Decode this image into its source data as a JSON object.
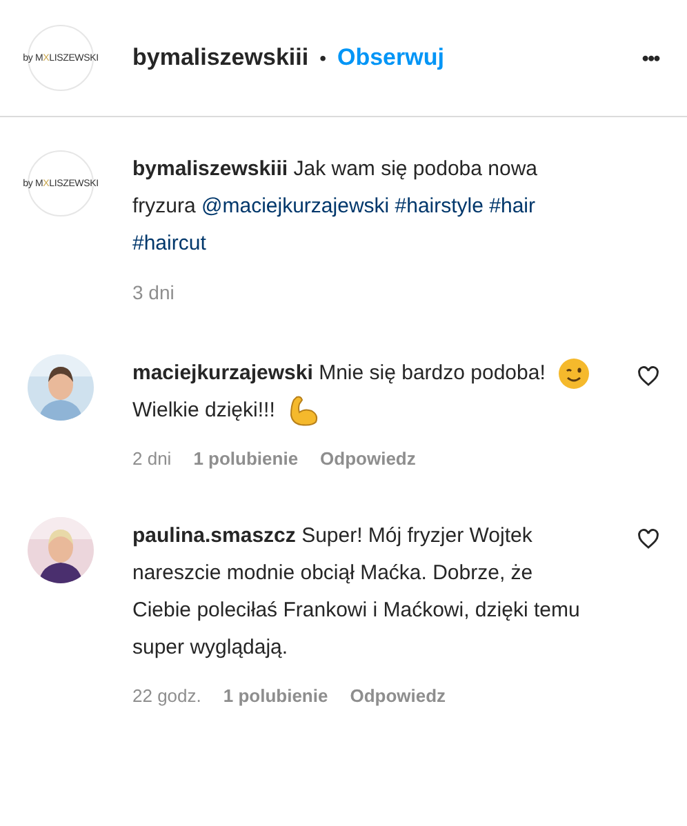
{
  "header": {
    "logo": {
      "prefix": "by M",
      "mark": "X",
      "suffix": "LISZEWSKI"
    },
    "username": "bymaliszewskiii",
    "separator": "•",
    "follow": "Obserwuj",
    "more": "•••"
  },
  "caption": {
    "logo": {
      "prefix": "by M",
      "mark": "X",
      "suffix": "LISZEWSKI"
    },
    "username": "bymaliszewskiii",
    "segments": [
      {
        "kind": "text",
        "text": "Jak wam się podoba nowa fryzura"
      },
      {
        "kind": "link",
        "text": "@maciejkurzajewski"
      },
      {
        "kind": "link",
        "text": "#hairstyle"
      },
      {
        "kind": "link",
        "text": "#hair"
      },
      {
        "kind": "link",
        "text": "#haircut"
      }
    ],
    "time": "3 dni"
  },
  "comments": [
    {
      "username": "maciejkurzajewski",
      "avatar": {
        "kind": "picture"
      },
      "segments": [
        {
          "kind": "text",
          "text": "Mnie się bardzo podoba!"
        },
        {
          "kind": "wink"
        },
        {
          "kind": "text",
          "text": "Wielkie dzięki!!!"
        },
        {
          "kind": "muscle"
        }
      ],
      "time": "2 dni",
      "likes": "1 polubienie",
      "reply": "Odpowiedz",
      "liked": false
    },
    {
      "username": "paulina.smaszcz",
      "avatar": {
        "kind": "picture"
      },
      "segments": [
        {
          "kind": "text",
          "text": "Super! Mój fryzjer Wojtek nareszcie modnie obciął Maćka. Dobrze, że Ciebie poleciłaś Frankowi i Maćkowi, dzięki temu super wyglądają."
        }
      ],
      "time": "22 godz.",
      "likes": "1 polubienie",
      "reply": "Odpowiedz",
      "liked": false
    }
  ]
}
